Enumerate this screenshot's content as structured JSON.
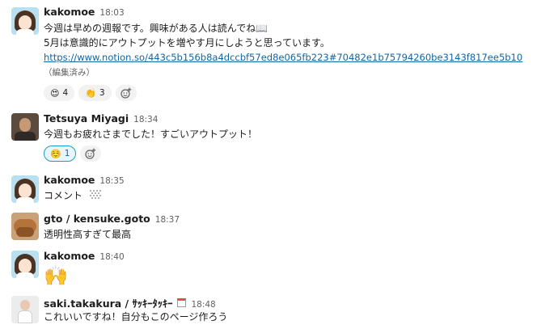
{
  "messages": [
    {
      "author": "kakomoe",
      "time": "18:03",
      "lines": [
        "今週は早めの週報です。興味がある人は読んでね📖",
        "5月は意識的にアウトプットを増やす月にしようと思っています。"
      ],
      "link": "https://www.notion.so/443c5b156b8a4dccbf57ed8e065fb223#70482e1b75794260be3143f817ee5b10",
      "edited": "（編集済み）",
      "reactions": [
        {
          "emoji": "😍",
          "count": "4"
        },
        {
          "emoji": "👏",
          "count": "3"
        }
      ]
    },
    {
      "author": "Tetsuya Miyagi",
      "time": "18:34",
      "lines": [
        "今週もお疲れさまでした！すごいアウトプット！"
      ],
      "reactions": [
        {
          "emoji": "☺️",
          "count": "1"
        }
      ]
    },
    {
      "author": "kakomoe",
      "time": "18:35",
      "lines": [
        "コメント"
      ]
    },
    {
      "author": "gto / kensuke.goto",
      "time": "18:37",
      "lines": [
        "透明性高すぎて最高"
      ]
    },
    {
      "author": "kakomoe",
      "time": "18:40",
      "lines": [
        "🙌"
      ]
    },
    {
      "author": "saki.takakura / ｻｯｷｰﾀｯｷｰ",
      "time": "18:48",
      "lines": [
        "これいいですね！自分もこのページ作ろう"
      ]
    }
  ],
  "icons": {
    "add_reaction": "add-reaction-icon",
    "custom_emoji": "custom-emoji-icon",
    "status": "calendar-status-icon"
  },
  "colors": {
    "link": "#1264a3",
    "active_reaction_bg": "#e8f5fa",
    "active_reaction_border": "#1d9bd1"
  }
}
